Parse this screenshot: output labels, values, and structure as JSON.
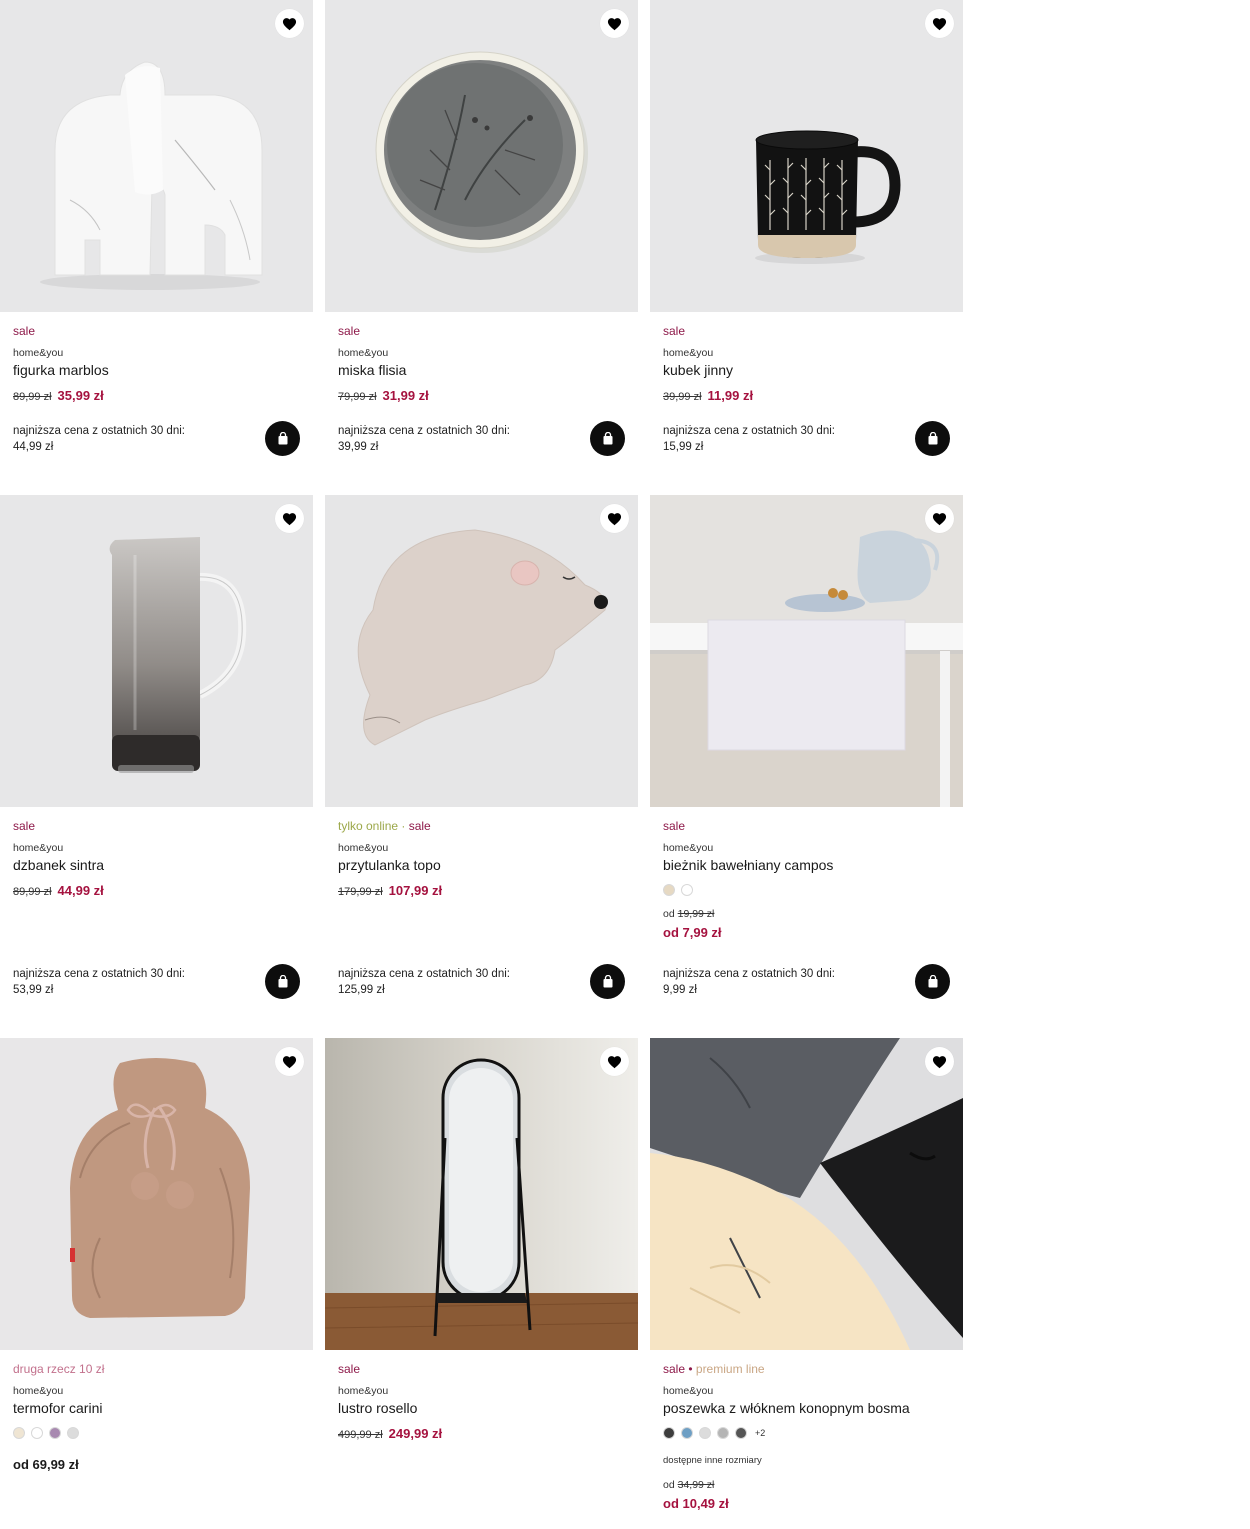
{
  "icons": {
    "favorite": "heart-icon",
    "cart": "shopping-bag-icon"
  },
  "colors": {
    "sale": "#8e1a4a",
    "price": "#a5123f",
    "online": "#9ca84a",
    "premium": "#c9a684",
    "promo": "#c2708c"
  },
  "products": [
    {
      "tag1": "sale",
      "brand": "home&you",
      "name": "figurka marblos",
      "old_price": "89,99 zł",
      "new_price": "35,99 zł",
      "lowest_label": "najniższa cena z ostatnich 30 dni:",
      "lowest_value": "44,99 zł"
    },
    {
      "tag1": "sale",
      "brand": "home&you",
      "name": "miska flisia",
      "old_price": "79,99 zł",
      "new_price": "31,99 zł",
      "lowest_label": "najniższa cena z ostatnich 30 dni:",
      "lowest_value": "39,99 zł"
    },
    {
      "tag1": "sale",
      "brand": "home&you",
      "name": "kubek jinny",
      "old_price": "39,99 zł",
      "new_price": "11,99 zł",
      "lowest_label": "najniższa cena z ostatnich 30 dni:",
      "lowest_value": "15,99 zł"
    },
    {
      "tag1": "sale",
      "brand": "home&you",
      "name": "dzbanek sintra",
      "old_price": "89,99 zł",
      "new_price": "44,99 zł",
      "lowest_label": "najniższa cena z ostatnich 30 dni:",
      "lowest_value": "53,99 zł"
    },
    {
      "tag1": "tylko online",
      "tag_sep": " · ",
      "tag2": "sale",
      "brand": "home&you",
      "name": "przytulanka topo",
      "old_price": "179,99 zł",
      "new_price": "107,99 zł",
      "lowest_label": "najniższa cena z ostatnich 30 dni:",
      "lowest_value": "125,99 zł"
    },
    {
      "tag1": "sale",
      "brand": "home&you",
      "name": "bieżnik bawełniany campos",
      "swatches": [
        "#e6d9c3",
        "#ffffff"
      ],
      "from_prefix": "od",
      "old_price": "19,99 zł",
      "new_price": "od 7,99 zł",
      "lowest_label": "najniższa cena z ostatnich 30 dni:",
      "lowest_value": "9,99 zł"
    },
    {
      "tag1": "druga rzecz 10 zł",
      "brand": "home&you",
      "name": "termofor carini",
      "swatches": [
        "#efe5d3",
        "#ffffff",
        "#a889b0",
        "#dcdcdc"
      ],
      "new_price": "od 69,99 zł"
    },
    {
      "tag1": "sale",
      "brand": "home&you",
      "name": "lustro rosello",
      "old_price": "499,99 zł",
      "new_price": "249,99 zł"
    },
    {
      "tag1": "sale",
      "tag_sep": " • ",
      "tag2": "premium line",
      "brand": "home&you",
      "name": "poszewka z włóknem konopnym bosma",
      "swatches": [
        "#3d3d3d",
        "#6e9fc4",
        "#dcdcdc",
        "#b5b5b5",
        "#555555"
      ],
      "more_colors": "+2",
      "sizes_note": "dostępne inne rozmiary",
      "from_prefix": "od",
      "old_price": "34,99 zł",
      "new_price": "od 10,49 zł"
    }
  ]
}
